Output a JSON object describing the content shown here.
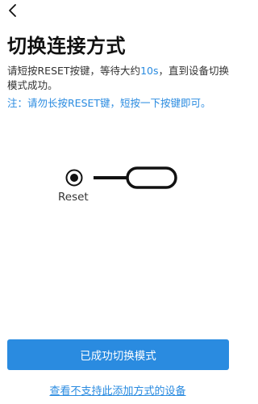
{
  "header": {
    "back_icon": "chevron-left-icon"
  },
  "main": {
    "title": "切换连接方式",
    "description_part1": "请短按RESET按键，等待大约",
    "description_highlight": "10s",
    "description_part2": "，直到设备切换模式成功。",
    "note": "注：请勿长按RESET键，短按一下按键即可。",
    "illustration_label": "Reset"
  },
  "actions": {
    "primary_button_label": "已成功切换模式",
    "secondary_link_label": "查看不支持此添加方式的设备"
  },
  "colors": {
    "accent": "#2a8be0",
    "text": "#111111"
  }
}
